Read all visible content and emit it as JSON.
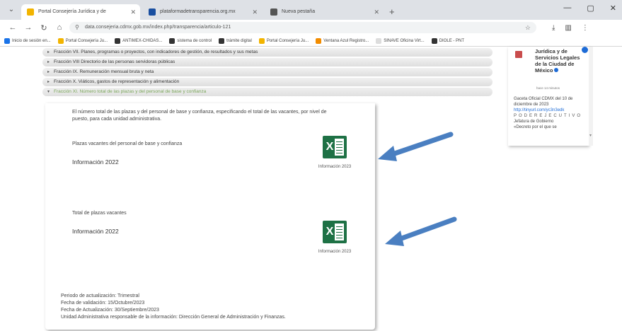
{
  "browser": {
    "tabs": [
      {
        "title": "Portal Consejería Jurídica y de",
        "active": true,
        "color": "#f2b400"
      },
      {
        "title": "plataformadetransparencia.org.mx",
        "active": false,
        "color": "#1a4fa0"
      },
      {
        "title": "Nueva pestaña",
        "active": false,
        "color": "#555555"
      }
    ],
    "url": "data.consejeria.cdmx.gob.mx/index.php/transparencia/articulo-121",
    "bookmarks": [
      {
        "label": "Inicio de sesión en...",
        "color": "#1a73e8"
      },
      {
        "label": "Portal Consejería Ju...",
        "color": "#f2b400"
      },
      {
        "label": "ANTIMEX-CHIDAS...",
        "color": "#333333"
      },
      {
        "label": "sistema de control",
        "color": "#333333"
      },
      {
        "label": "trámite digital",
        "color": "#333333"
      },
      {
        "label": "Portal Consejería Ju...",
        "color": "#f2b400"
      },
      {
        "label": "Ventana Azul Registro...",
        "color": "#f28c00"
      },
      {
        "label": "SINAVE Oficina Virt...",
        "color": "#dddddd"
      },
      {
        "label": "DIOLE - PNT",
        "color": "#333333"
      }
    ]
  },
  "accordion": [
    {
      "label": "Fracción VII. Planes, programas o proyectos, con indicadores de gestión, de resultados y sus metas",
      "open": false
    },
    {
      "label": "Fracción VIII Directorio de las personas servidoras públicas",
      "open": false
    },
    {
      "label": "Fracción IX. Remuneración mensual bruta y neta",
      "open": false
    },
    {
      "label": "Fracción X. Viáticos, gastos de representación y alimentación",
      "open": false
    },
    {
      "label": "Fracción XI. Número total de las plazas y del personal de base y confianza",
      "open": true
    }
  ],
  "panel": {
    "description": "El número total de las plazas y del personal de base y confianza, especificando el total de las vacantes, por nivel de puesto, para cada unidad administrativa.",
    "sections": [
      {
        "label": "Plazas vacantes del personal de base y confianza",
        "info": "Información 2022",
        "file_caption": "Información 2023"
      },
      {
        "label": "Total de plazas vacantes",
        "info": "Información 2022",
        "file_caption": "Información 2023"
      }
    ],
    "footer": [
      "Periodo de actualización: Trimestral",
      "Fecha de validación: 15/Octubre/2023",
      "Fecha de Actualización: 30/Septiembre/2023",
      "Unidad Administrativa responsable de la información: Dirección General de Administración y Finanzas."
    ]
  },
  "sidebar": {
    "title": "Jurídica y de Servicios Legales de la Ciudad de México",
    "subtitle": "hace 14 minutos",
    "line1": "Gaceta Oficial CDMX del 10 de diciembre de 2023",
    "link": "http://tinyurl.com/yc3n3edk",
    "spaced": "PODEREJECUTIVO",
    "line2": "Jefatura de Gobierno",
    "line3": "«Decreto por el que se"
  },
  "colors": {
    "accent_green": "#7aa55a",
    "excel_green": "#1e7145",
    "arrow_blue": "#4a7fc1"
  }
}
